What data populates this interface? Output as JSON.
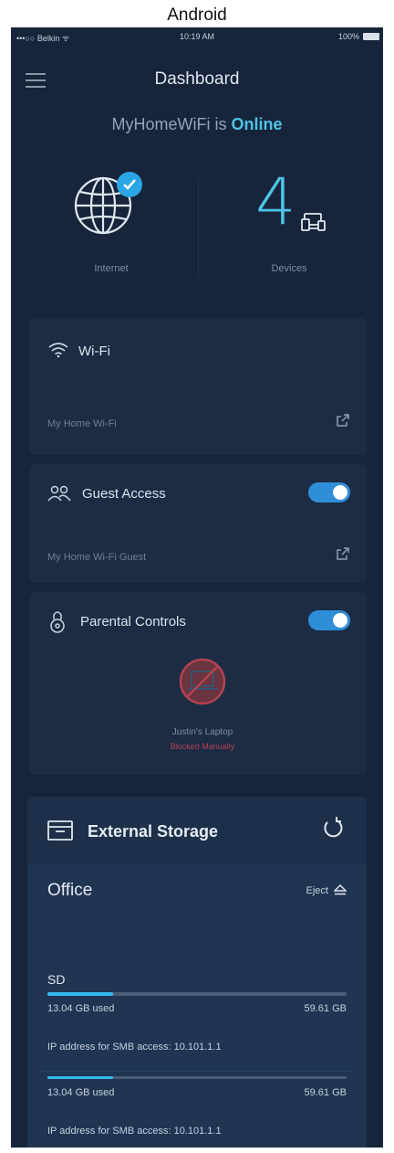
{
  "caption": "Android",
  "statusbar": {
    "carrier": "•••○○ Belkin ᯤ",
    "time": "10:19 AM",
    "battery": "100%"
  },
  "header": {
    "title": "Dashboard"
  },
  "network": {
    "name_prefix": "MyHomeWiFi is",
    "status": "Online"
  },
  "internet": {
    "label": "Internet"
  },
  "devices": {
    "count": "4",
    "label": "Devices"
  },
  "wifi": {
    "title": "Wi-Fi",
    "network_name": "My Home Wi-Fi"
  },
  "guest": {
    "title": "Guest Access",
    "network_name": "My Home Wi-Fi Guest",
    "enabled": true
  },
  "parental": {
    "title": "Parental Controls",
    "enabled": true,
    "device_name": "Justin's Laptop",
    "device_status": "Blocked Manually"
  },
  "storage": {
    "title": "External Storage",
    "drive_name": "Office",
    "eject_label": "Eject",
    "partitions": [
      {
        "name": "SD",
        "used": "13.04 GB used",
        "total": "59.61 GB",
        "fraction": 0.22,
        "smb": "IP address for SMB access: 10.101.1.1"
      },
      {
        "name": "",
        "used": "13.04 GB used",
        "total": "59.61 GB",
        "fraction": 0.22,
        "smb": "IP address for SMB access: 10.101.1.1"
      }
    ]
  },
  "colors": {
    "background": "#16253b",
    "accent": "#4fc3e8",
    "toggle": "#2e8ed8",
    "blocked": "#b3434f"
  },
  "icons": [
    "menu-icon",
    "globe-icon",
    "check-icon",
    "devices-icon",
    "wifi-icon",
    "guest-icon",
    "lock-icon",
    "external-link-icon",
    "blocked-laptop-icon",
    "storage-icon",
    "refresh-icon",
    "eject-icon"
  ]
}
